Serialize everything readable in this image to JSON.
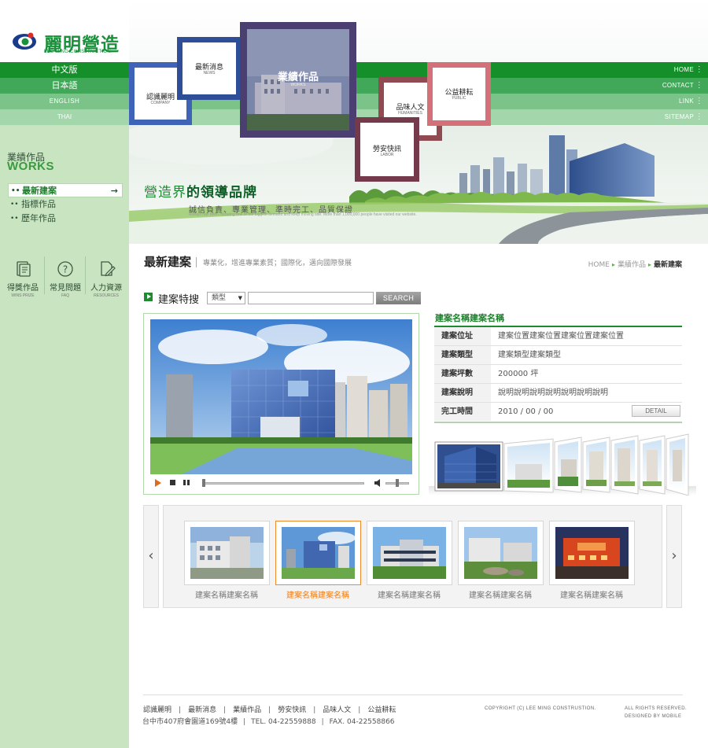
{
  "brand": {
    "name_cn": "麗明營造",
    "name_en": "LEE MING CONSTRUCTION",
    "color": "#19913b"
  },
  "languages": [
    "中文版",
    "日本語",
    "ENGLISH",
    "THAI"
  ],
  "topnav": [
    "HOME",
    "CONTACT",
    "LINK",
    "SITEMAP"
  ],
  "banner": {
    "boxes": [
      {
        "cn": "認識麗明",
        "en": "COMPANY"
      },
      {
        "cn": "最新消息",
        "en": "NEWS"
      },
      {
        "cn": "業績作品",
        "en": "WORKS"
      },
      {
        "cn": "品味人文",
        "en": "HUMANITIES"
      },
      {
        "cn": "公益耕耘",
        "en": "PUBLIC"
      },
      {
        "cn": "勞安快訊",
        "en": "LABOR"
      }
    ],
    "slogan_pre": "營造界",
    "slogan_bold": "的領導品牌",
    "slogan_sub": "誠信負責、專業管理、準時完工、品質保證",
    "slogan_tiny": "Always has been following one of the biggest demand and keep moving tide. More than 1,000,000 people have visited our website."
  },
  "sidebar": {
    "section_cn": "業績作品",
    "section_en": "WORKS",
    "items": [
      "最新建案",
      "指標作品",
      "歷年作品"
    ],
    "active_index": 0,
    "quick": [
      {
        "label": "得獎作品",
        "en": "WINS PRIZE",
        "icon": "document-icon"
      },
      {
        "label": "常見問題",
        "en": "FAQ",
        "icon": "question-icon"
      },
      {
        "label": "人力資源",
        "en": "RESOURCES",
        "icon": "edit-document-icon"
      }
    ]
  },
  "page": {
    "title": "最新建案",
    "subtitle": "專業化，增進專業素質；國際化，邁向國際發展",
    "breadcrumb": [
      "HOME",
      "業績作品",
      "最新建案"
    ]
  },
  "search": {
    "label": "建案特搜",
    "select_value": "類型",
    "input_value": "",
    "button": "SEARCH"
  },
  "project": {
    "name": "建案名稱建案名稱",
    "rows": [
      {
        "label": "建案位址",
        "value": "建案位置建案位置建案位置建案位置"
      },
      {
        "label": "建案類型",
        "value": "建案類型建案類型"
      },
      {
        "label": "建案坪數",
        "value": "200000 坪"
      },
      {
        "label": "建案說明",
        "value": "說明說明說明說明說明說明說明"
      },
      {
        "label": "完工時間",
        "value": "2010 / 00 / 00"
      }
    ],
    "detail_button": "DETAIL"
  },
  "carousel": {
    "selected_index": 1,
    "items": [
      {
        "caption": "建案名稱建案名稱"
      },
      {
        "caption": "建案名稱建案名稱"
      },
      {
        "caption": "建案名稱建案名稱"
      },
      {
        "caption": "建案名稱建案名稱"
      },
      {
        "caption": "建案名稱建案名稱"
      }
    ]
  },
  "footer": {
    "links": [
      "認識麗明",
      "最新消息",
      "業績作品",
      "勞安快訊",
      "品味人文",
      "公益耕耘"
    ],
    "address": "台中市407府會園道169號4樓",
    "tel": "TEL. 04-22559888",
    "fax": "FAX. 04-22558866",
    "copyright": "COPYRIGHT (C) LEE MING CONSTRUSTION.",
    "rights": "ALL RIGHTS RESERVED.",
    "designed_by": "DESIGNED BY MOBILE"
  }
}
